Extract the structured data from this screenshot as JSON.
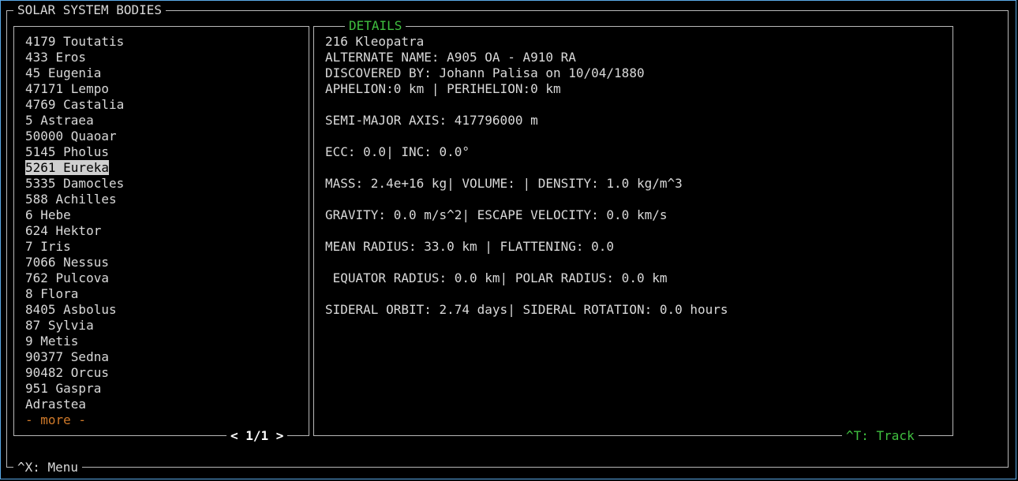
{
  "outer": {
    "title": "SOLAR SYSTEM BODIES",
    "menu_hint": "^X: Menu"
  },
  "list": {
    "items": [
      "4179 Toutatis",
      "433 Eros",
      "45 Eugenia",
      "47171 Lempo",
      "4769 Castalia",
      "5 Astraea",
      "50000 Quaoar",
      "5145 Pholus",
      "5261 Eureka",
      "5335 Damocles",
      "588 Achilles",
      "6 Hebe",
      "624 Hektor",
      "7 Iris",
      "7066 Nessus",
      "762 Pulcova",
      "8 Flora",
      "8405 Asbolus",
      "87 Sylvia",
      "9 Metis",
      "90377 Sedna",
      "90482 Orcus",
      "951 Gaspra",
      "Adrastea"
    ],
    "selected_label": "5261 Eureka",
    "more": "- more -",
    "pager": "< 1/1 >"
  },
  "details": {
    "title": "DETAILS",
    "name": "216 Kleopatra",
    "alternate_name": "ALTERNATE NAME: A905 OA - A910 RA",
    "discovered_by": "DISCOVERED BY: Johann Palisa on 10/04/1880",
    "aphelion_perihelion": "APHELION:0 km | PERIHELION:0 km",
    "semi_major_axis": "SEMI-MAJOR AXIS: 417796000 m",
    "ecc_inc": "ECC: 0.0| INC: 0.0°",
    "mass_volume_density": "MASS: 2.4e+16 kg| VOLUME: | DENSITY: 1.0 kg/m^3",
    "gravity_escape": "GRAVITY: 0.0 m/s^2| ESCAPE VELOCITY: 0.0 km/s",
    "mean_radius_flattening": "MEAN RADIUS: 33.0 km | FLATTENING: 0.0",
    "equator_polar": " EQUATOR RADIUS: 0.0 km| POLAR RADIUS: 0.0 km",
    "sideral": "SIDERAL ORBIT: 2.74 days| SIDERAL ROTATION: 0.0 hours",
    "track_hint": "^T: Track"
  },
  "colors": {
    "accent_green": "#3fbf3f",
    "more_orange": "#d07a2a",
    "screen_border": "#5aa9e6",
    "selection_bg": "#cfcfcf"
  }
}
